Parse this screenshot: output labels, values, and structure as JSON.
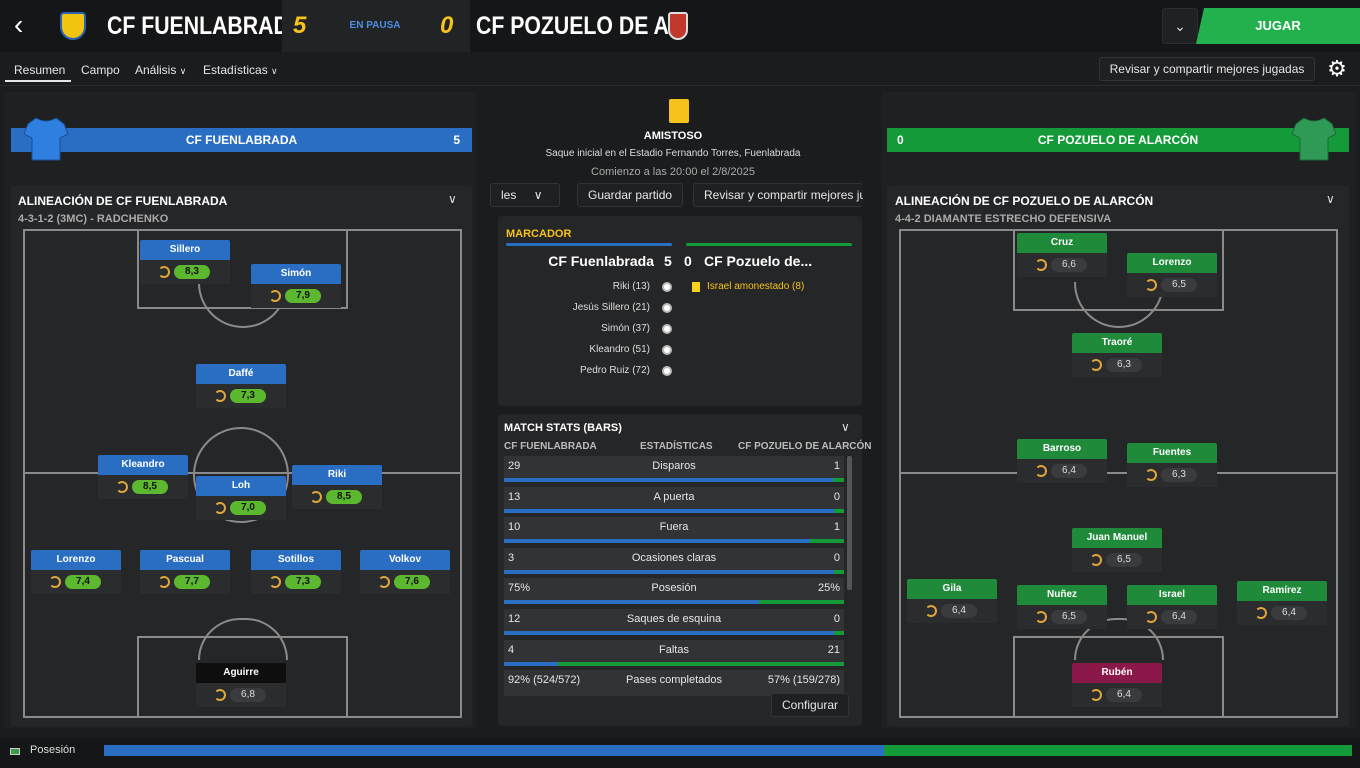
{
  "header": {
    "home_team": "CF FUENLABRADA",
    "home_score": "5",
    "status": "EN PAUSA",
    "away_score": "0",
    "away_team": "CF POZUELO DE A...",
    "play_label": "JUGAR"
  },
  "tabs": [
    "Resumen",
    "Campo",
    "Análisis",
    "Estadísticas"
  ],
  "review_button": "Revisar y compartir mejores jugadas",
  "home_panel": {
    "team": "CF FUENLABRADA",
    "goals": "5",
    "lineup_title": "ALINEACIÓN DE CF FUENLABRADA",
    "formation": "4-3-1-2 (3MC) - RADCHENKO",
    "players": [
      {
        "name": "Sillero",
        "rating": "8,3",
        "hi": true
      },
      {
        "name": "Simón",
        "rating": "7,9",
        "hi": true
      },
      {
        "name": "Daffé",
        "rating": "7,3",
        "hi": true
      },
      {
        "name": "Kleandro",
        "rating": "8,5",
        "hi": true
      },
      {
        "name": "Loh",
        "rating": "7,0",
        "hi": true
      },
      {
        "name": "Riki",
        "rating": "8,5",
        "hi": true
      },
      {
        "name": "Lorenzo",
        "rating": "7,4",
        "hi": true
      },
      {
        "name": "Pascual",
        "rating": "7,7",
        "hi": true
      },
      {
        "name": "Sotillos",
        "rating": "7,3",
        "hi": true
      },
      {
        "name": "Volkov",
        "rating": "7,6",
        "hi": true
      },
      {
        "name": "Aguirre",
        "rating": "6,8",
        "hi": false
      }
    ]
  },
  "away_panel": {
    "team": "CF POZUELO DE ALARCÓN",
    "goals": "0",
    "lineup_title": "ALINEACIÓN DE CF POZUELO DE ALARCÓN",
    "formation": "4-4-2 DIAMANTE ESTRECHO DEFENSIVA",
    "players": [
      {
        "name": "Cruz",
        "rating": "6,6"
      },
      {
        "name": "Lorenzo",
        "rating": "6,5"
      },
      {
        "name": "Traoré",
        "rating": "6,3"
      },
      {
        "name": "Barroso",
        "rating": "6,4"
      },
      {
        "name": "Fuentes",
        "rating": "6,3"
      },
      {
        "name": "Juan Manuel",
        "rating": "6,5"
      },
      {
        "name": "Gila",
        "rating": "6,4"
      },
      {
        "name": "Nuñez",
        "rating": "6,5"
      },
      {
        "name": "Israel",
        "rating": "6,4"
      },
      {
        "name": "Ramírez",
        "rating": "6,4"
      },
      {
        "name": "Rubén",
        "rating": "6,4"
      }
    ]
  },
  "match": {
    "competition": "AMISTOSO",
    "venue": "Saque inicial en el Estadio Fernando Torres, Fuenlabrada",
    "kickoff": "Comienzo a las 20:00 el 2/8/2025",
    "btn_partial": "les",
    "save_label": "Guardar partido",
    "review_partial": "Revisar y compartir mejores ju"
  },
  "scoreboard": {
    "title": "MARCADOR",
    "home": "CF Fuenlabrada",
    "home_goals": "5",
    "away_goals": "0",
    "away": "CF Pozuelo de...",
    "scorers": [
      "Riki (13)",
      "Jesús Sillero (21)",
      "Simón (37)",
      "Kleandro (51)",
      "Pedro Ruiz (72)"
    ],
    "away_event": "Israel amonestado (8)"
  },
  "stats": {
    "title": "MATCH STATS (BARS)",
    "col_home": "CF FUENLABRADA",
    "col_mid": "ESTADÍSTICAS",
    "col_away": "CF POZUELO DE ALARCÓN",
    "rows": [
      {
        "home": "29",
        "label": "Disparos",
        "away": "1",
        "home_share": 0.967
      },
      {
        "home": "13",
        "label": "A puerta",
        "away": "0",
        "home_share": 0.97
      },
      {
        "home": "10",
        "label": "Fuera",
        "away": "1",
        "home_share": 0.9
      },
      {
        "home": "3",
        "label": "Ocasiones claras",
        "away": "0",
        "home_share": 0.97
      },
      {
        "home": "75%",
        "label": "Posesión",
        "away": "25%",
        "home_share": 0.75
      },
      {
        "home": "12",
        "label": "Saques de esquina",
        "away": "0",
        "home_share": 0.97
      },
      {
        "home": "4",
        "label": "Faltas",
        "away": "21",
        "home_share": 0.16
      },
      {
        "home": "92% (524/572)",
        "label": "Pases completados",
        "away": "57% (159/278)",
        "home_share": 0.62
      }
    ],
    "configure": "Configurar"
  },
  "bottom": {
    "label": "Posesión",
    "home_share": 0.75
  },
  "colors": {
    "home": "#2a6ec4",
    "away": "#159a3a",
    "play": "#22b14c",
    "score": "#f7c21b"
  }
}
